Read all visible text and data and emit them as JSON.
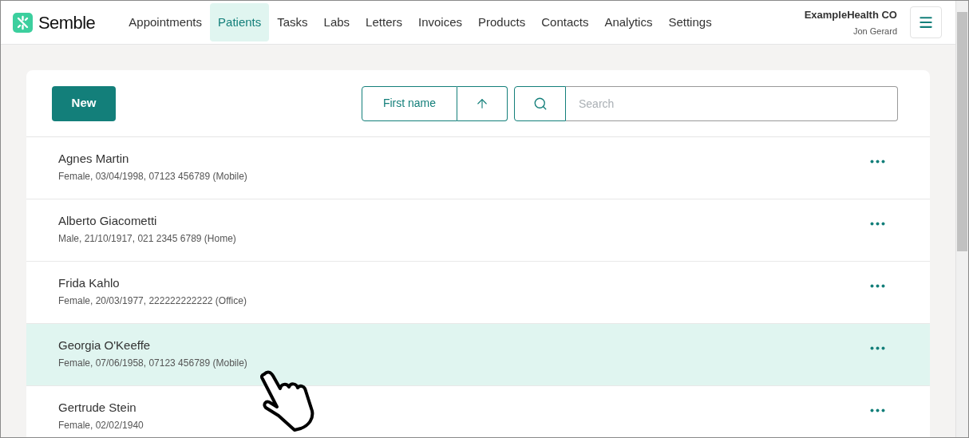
{
  "header": {
    "logo": "Semble",
    "nav": [
      {
        "label": "Appointments",
        "selected": false
      },
      {
        "label": "Patients",
        "selected": true
      },
      {
        "label": "Tasks",
        "selected": false
      },
      {
        "label": "Labs",
        "selected": false
      },
      {
        "label": "Letters",
        "selected": false
      },
      {
        "label": "Invoices",
        "selected": false
      },
      {
        "label": "Products",
        "selected": false
      },
      {
        "label": "Contacts",
        "selected": false
      },
      {
        "label": "Analytics",
        "selected": false
      },
      {
        "label": "Settings",
        "selected": false
      }
    ],
    "account": {
      "organisation": "ExampleHealth CO",
      "user": "Jon Gerard"
    }
  },
  "toolbar": {
    "new_button": "New",
    "sort": {
      "label": "First name"
    },
    "search": {
      "placeholder": "Search"
    }
  },
  "patients": [
    {
      "name": "Agnes Martin",
      "details": "Female, 03/04/1998, 07123 456789 (Mobile)",
      "selected": false
    },
    {
      "name": "Alberto Giacometti",
      "details": "Male, 21/10/1917, 021 2345 6789 (Home)",
      "selected": false
    },
    {
      "name": "Frida Kahlo",
      "details": "Female, 20/03/1977, 222222222222 (Office)",
      "selected": false
    },
    {
      "name": "Georgia O'Keeffe",
      "details": "Female, 07/06/1958, 07123 456789 (Mobile)",
      "selected": true
    },
    {
      "name": "Gertrude Stein",
      "details": "Female, 02/02/1940",
      "selected": false
    }
  ]
}
